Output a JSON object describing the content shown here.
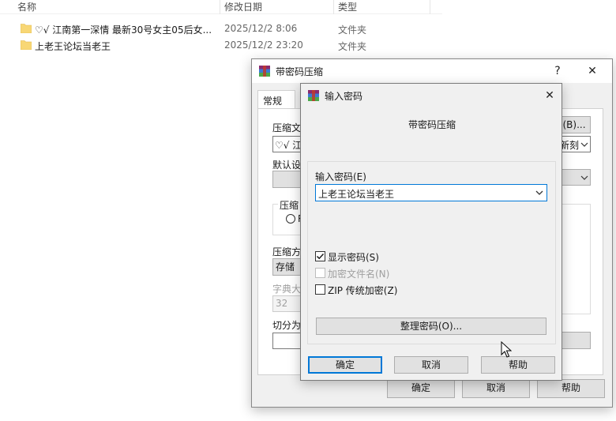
{
  "explorer": {
    "columns": [
      "名称",
      "修改日期",
      "类型"
    ],
    "rows": [
      {
        "name": "♡√ 江南第一深情 最新30号女主05后女...",
        "date": "2025/12/2 8:06",
        "type": "文件夹"
      },
      {
        "name": "上老王论坛当老王",
        "date": "2025/12/2 23:20",
        "type": "文件夹"
      }
    ]
  },
  "outer_dialog": {
    "title": "带密码压缩",
    "help_glyph": "?",
    "close_glyph": "✕",
    "tab": "常规",
    "labels": {
      "archive_name": "压缩文",
      "archive_value": "♡√ 江",
      "browse": "(B)...",
      "update_mode": "新刻",
      "default_profile": "默认设",
      "format_group": "压缩",
      "format_radio": "R",
      "method": "压缩方",
      "method_value": "存储",
      "dict": "字典大",
      "dict_value": "32",
      "split": "切分为"
    },
    "buttons": {
      "ok": "确定",
      "cancel": "取消",
      "help": "帮助"
    }
  },
  "inner_dialog": {
    "title": "输入密码",
    "close_glyph": "✕",
    "heading": "带密码压缩",
    "password_label": "输入密码(E)",
    "password_value": "上老王论坛当老王",
    "show_password": "显示密码(S)",
    "encrypt_names": "加密文件名(N)",
    "zip_legacy": "ZIP 传统加密(Z)",
    "organize": "整理密码(O)...",
    "buttons": {
      "ok": "确定",
      "cancel": "取消",
      "help": "帮助"
    }
  },
  "colors": {
    "accent": "#0078d7",
    "folder": "#f8d775"
  },
  "state": {
    "show_password": true,
    "encrypt_names": false,
    "zip_legacy": false
  }
}
